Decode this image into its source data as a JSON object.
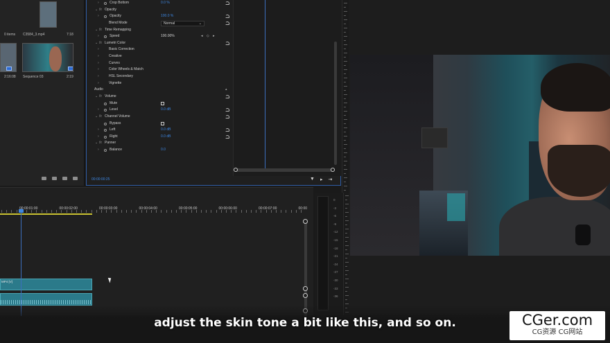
{
  "project_panel": {
    "items": [
      {
        "name": "0 items",
        "duration": ""
      },
      {
        "name": "C3584_3.mp4",
        "duration": "7:18"
      },
      {
        "name": "",
        "duration": "2:16:08"
      },
      {
        "name": "Sequence 03",
        "duration": "2:19"
      }
    ]
  },
  "effect_controls": {
    "rows": [
      {
        "level": 2,
        "twirl": true,
        "stopwatch": true,
        "label": "Crop Bottom",
        "value": "0.0 %",
        "reset": true
      },
      {
        "level": 1,
        "twirl": "open",
        "fx": true,
        "label": "Opacity"
      },
      {
        "level": 2,
        "twirl": true,
        "stopwatch": true,
        "label": "Opacity",
        "value": "100.0 %",
        "reset": true
      },
      {
        "level": 2,
        "label": "Blend Mode",
        "dropdown": "Normal",
        "reset": true
      },
      {
        "level": 1,
        "twirl": "open",
        "fx": true,
        "label": "Time Remapping"
      },
      {
        "level": 2,
        "twirl": true,
        "stopwatch": true,
        "label": "Speed",
        "value": "100.00%",
        "white": true,
        "keyframes": "◂ ◇ ▸"
      },
      {
        "level": 1,
        "twirl": "open",
        "fx": true,
        "label": "Lumetri Color",
        "reset": true
      },
      {
        "level": 2,
        "twirl": true,
        "label": "Basic Correction"
      },
      {
        "level": 2,
        "twirl": true,
        "label": "Creative"
      },
      {
        "level": 2,
        "twirl": true,
        "label": "Curves"
      },
      {
        "level": 2,
        "twirl": true,
        "label": "Color Wheels & Match"
      },
      {
        "level": 2,
        "twirl": true,
        "label": "HSL Secondary"
      },
      {
        "level": 2,
        "twirl": true,
        "label": "Vignette"
      },
      {
        "level": 0,
        "label": "Audio",
        "collapse": true
      },
      {
        "level": 1,
        "twirl": "open",
        "fx": true,
        "label": "Volume",
        "reset": true
      },
      {
        "level": 2,
        "stopwatch": true,
        "label": "Mute",
        "checkbox": true
      },
      {
        "level": 2,
        "twirl": true,
        "stopwatch": true,
        "label": "Level",
        "value": "0.0 dB",
        "reset": true
      },
      {
        "level": 1,
        "twirl": "open",
        "fx": true,
        "label": "Channel Volume",
        "reset": true
      },
      {
        "level": 2,
        "stopwatch": true,
        "label": "Bypass",
        "checkbox": true
      },
      {
        "level": 2,
        "twirl": true,
        "stopwatch": true,
        "label": "Left",
        "value": "0.0 dB",
        "reset": true
      },
      {
        "level": 2,
        "twirl": true,
        "stopwatch": true,
        "label": "Right",
        "value": "0.0 dB",
        "reset": true
      },
      {
        "level": 1,
        "twirl": "open",
        "fx": true,
        "label": "Panner"
      },
      {
        "level": 2,
        "twirl": true,
        "stopwatch": true,
        "label": "Balance",
        "value": "0.0"
      }
    ],
    "current_time": "00:00:00:25"
  },
  "timeline": {
    "timecodes": [
      "00:00:01:00",
      "00:00:02:00",
      "00:00:03:00",
      "00:00:04:00",
      "00:00:05:00",
      "00:00:06:00",
      "00:00:07:00",
      "00:00"
    ],
    "video_clip_label": "MP4 [V]"
  },
  "audio_meter": {
    "db_labels": [
      "0",
      "-3",
      "-6",
      "-9",
      "-12",
      "-15",
      "-18",
      "-21",
      "-24",
      "-27",
      "-30",
      "-33",
      "-36"
    ]
  },
  "subtitle": "adjust the skin tone a bit like this, and so on.",
  "watermark": {
    "main": "CGer.com",
    "sub": "CG资源 CG网站"
  }
}
